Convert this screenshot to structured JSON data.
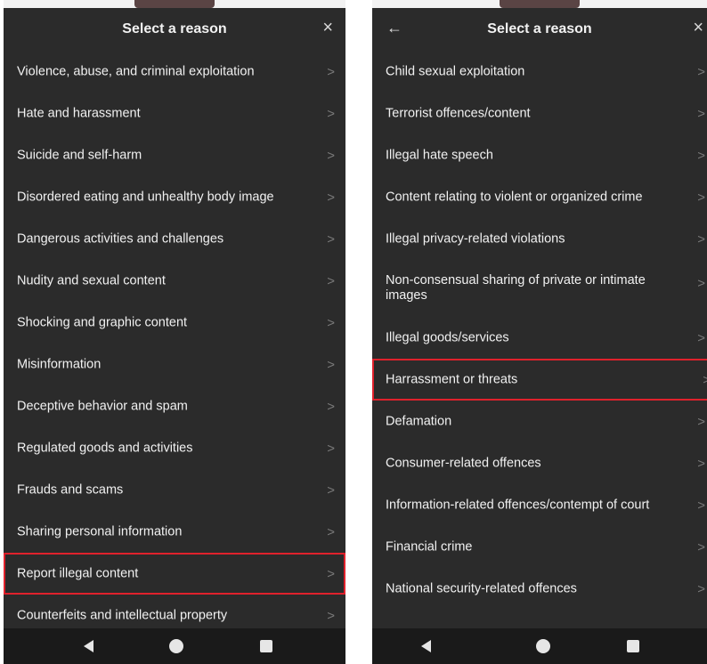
{
  "left": {
    "title": "Select a reason",
    "close": "×",
    "items": [
      {
        "label": "Violence, abuse, and criminal exploitation"
      },
      {
        "label": "Hate and harassment"
      },
      {
        "label": "Suicide and self-harm"
      },
      {
        "label": "Disordered eating and unhealthy body image"
      },
      {
        "label": "Dangerous activities and challenges"
      },
      {
        "label": "Nudity and sexual content"
      },
      {
        "label": "Shocking and graphic content"
      },
      {
        "label": "Misinformation"
      },
      {
        "label": "Deceptive behavior and spam"
      },
      {
        "label": "Regulated goods and activities"
      },
      {
        "label": "Frauds and scams"
      },
      {
        "label": "Sharing personal information"
      },
      {
        "label": "Report illegal content"
      },
      {
        "label": "Counterfeits and intellectual property"
      }
    ]
  },
  "right": {
    "title": "Select a reason",
    "back": "←",
    "close": "×",
    "items": [
      {
        "label": "Child sexual exploitation"
      },
      {
        "label": "Terrorist offences/content"
      },
      {
        "label": "Illegal hate speech"
      },
      {
        "label": "Content relating to violent or organized crime"
      },
      {
        "label": "Illegal privacy-related violations"
      },
      {
        "label": "Non-consensual sharing of private or intimate images"
      },
      {
        "label": "Illegal goods/services"
      },
      {
        "label": "Harrassment or threats"
      },
      {
        "label": "Defamation"
      },
      {
        "label": "Consumer-related offences"
      },
      {
        "label": "Information-related offences/contempt of court"
      },
      {
        "label": "Financial crime"
      },
      {
        "label": "National security-related offences"
      }
    ]
  },
  "chevron": ">",
  "highlight_color": "#e0212c",
  "background_color": "#2b2b2b"
}
